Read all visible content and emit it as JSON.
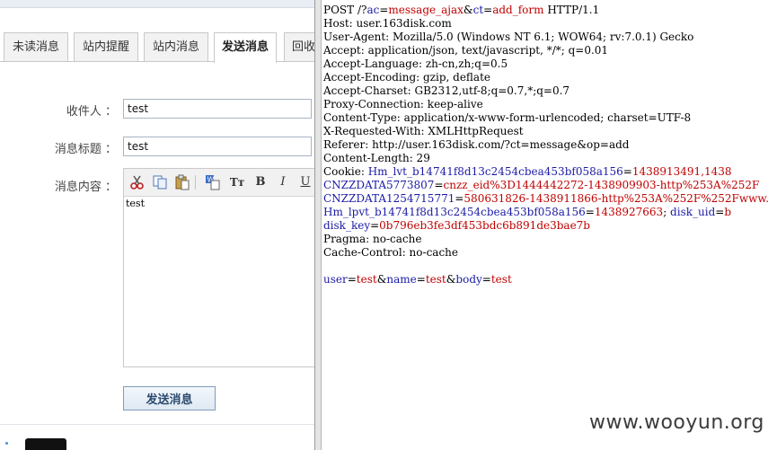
{
  "tabs": [
    {
      "label": "未读消息",
      "active": false
    },
    {
      "label": "站内提醒",
      "active": false
    },
    {
      "label": "站内消息",
      "active": false
    },
    {
      "label": "发送消息",
      "active": true
    },
    {
      "label": "回收",
      "active": false
    }
  ],
  "form": {
    "recipient_label": "收件人 ：",
    "recipient_value": "test",
    "subject_label": "消息标题 ：",
    "subject_value": "test",
    "content_label": "消息内容 ：",
    "content_value": "test",
    "send_label": "发送消息"
  },
  "editor_toolbar": [
    "cut-icon",
    "copy-icon",
    "paste-icon",
    "paste-word-icon",
    "font-size-icon",
    "bold-icon",
    "italic-icon",
    "underline-icon"
  ],
  "request": {
    "line1": {
      "a": "POST /?",
      "b": "ac",
      "c": "=",
      "d": "message_ajax",
      "e": "&",
      "f": "ct",
      "g": "=",
      "h": "add_form",
      "i": " HTTP/1.1"
    },
    "host": "Host: user.163disk.com",
    "user_agent": "User-Agent: Mozilla/5.0 (Windows NT 6.1; WOW64; rv:7.0.1) Gecko",
    "accept": "Accept: application/json, text/javascript, */*; q=0.01",
    "accept_language": "Accept-Language: zh-cn,zh;q=0.5",
    "accept_encoding": "Accept-Encoding: gzip, deflate",
    "accept_charset": "Accept-Charset: GB2312,utf-8;q=0.7,*;q=0.7",
    "proxy_connection": "Proxy-Connection: keep-alive",
    "content_type": "Content-Type: application/x-www-form-urlencoded; charset=UTF-8",
    "x_requested_with": "X-Requested-With: XMLHttpRequest",
    "referer": "Referer: http://user.163disk.com/?ct=message&op=add",
    "content_length": "Content-Length: 29",
    "cookie": {
      "prefix": "Cookie: ",
      "c1_name": "Hm_lvt_b14741f8d13c2454cbea453bf058a156",
      "c1_value": "1438913491,1438",
      "c2_name": "CNZZDATA5773807",
      "c2_value": "cnzz_eid%3D1444442272-1438909903-http%253A%252F",
      "c3_name": "CNZZDATA1254715771",
      "c3_value": "580631826-1438911866-http%253A%252F%252Fwww.",
      "c4_name": "Hm_lpvt_b14741f8d13c2454cbea453bf058a156",
      "c4_value": "1438927663",
      "c5_name": "disk_uid",
      "c5_value": "b",
      "c6_name": "disk_key",
      "c6_value": "0b796eb3fe3df453bdc6b891de3bae7b"
    },
    "pragma": "Pragma: no-cache",
    "cache_control": "Cache-Control: no-cache",
    "body": {
      "p1_name": "user",
      "p1_value": "test",
      "p2_name": "name",
      "p2_value": "test",
      "p3_name": "body",
      "p3_value": "test"
    }
  },
  "watermark": "www.wooyun.org",
  "colors": {
    "param_name": "#1a1aa6",
    "param_value": "#c00000"
  }
}
